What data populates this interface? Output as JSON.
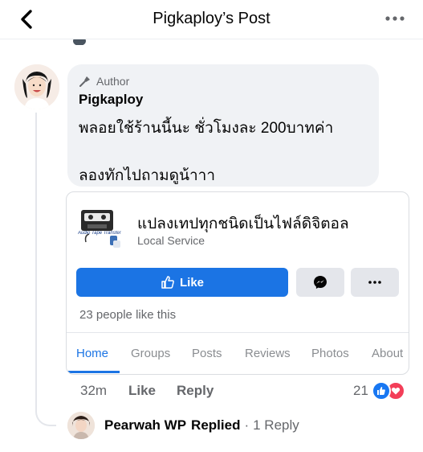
{
  "header": {
    "title": "Pigkaploy’s Post",
    "back_icon": "chevron-left-icon",
    "more_icon": "more-horizontal-icon"
  },
  "comment": {
    "badge_label": "Author",
    "badge_icon": "microphone-icon",
    "author_name": "Pigkaploy",
    "lines": [
      "พลอยใช้ร้านนี้นะ ชั่วโมงละ 200บาทค่า",
      "ลองทักไปถามดูน้าาา"
    ],
    "time": "32m",
    "like_label": "Like",
    "reply_label": "Reply",
    "reactions_count": "21",
    "reaction_icons": [
      "like-icon",
      "love-icon"
    ]
  },
  "page_card": {
    "thumb_caption": "Audio Tape Transfer",
    "page_name": "แปลงเทปทุกชนิดเป็นไฟล์ดิจิตอล",
    "category": "Local Service",
    "like_button_label": "Like",
    "likes_text": "23 people like this",
    "tabs": [
      "Home",
      "Groups",
      "Posts",
      "Reviews",
      "Photos",
      "About"
    ],
    "active_tab": "Home"
  },
  "replies": {
    "name": "Pearwah WP",
    "action": "Replied",
    "separator": "·",
    "count_label": "1 Reply"
  },
  "colors": {
    "primary_blue": "#1b74e4",
    "bubble_bg": "#f0f2f5",
    "secondary_text": "#65676b",
    "love_red": "#f33e58"
  }
}
